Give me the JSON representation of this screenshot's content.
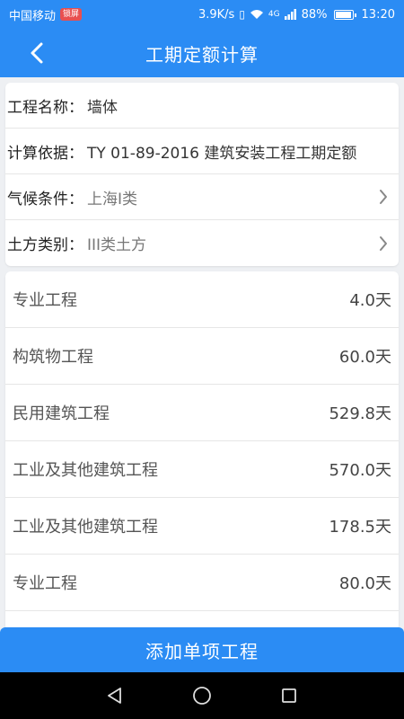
{
  "status_bar": {
    "carrier": "中国移动",
    "carrier_badge": "锁屏",
    "speed": "3.9K/s",
    "network": "4G",
    "battery": "88%",
    "time": "13:20"
  },
  "header": {
    "title": "工期定额计算"
  },
  "info": {
    "rows": [
      {
        "label": "工程名称：",
        "value": "墙体"
      },
      {
        "label": "计算依据：",
        "value": "TY 01-89-2016 建筑安装工程工期定额"
      },
      {
        "label": "气候条件：",
        "value": "上海I类"
      },
      {
        "label": "土方类别：",
        "value": "III类土方"
      }
    ]
  },
  "list": {
    "items": [
      {
        "name": "专业工程",
        "days": "4.0天"
      },
      {
        "name": "构筑物工程",
        "days": "60.0天"
      },
      {
        "name": "民用建筑工程",
        "days": "529.8天"
      },
      {
        "name": "工业及其他建筑工程",
        "days": "570.0天"
      },
      {
        "name": "工业及其他建筑工程",
        "days": "178.5天"
      },
      {
        "name": "专业工程",
        "days": "80.0天"
      }
    ]
  },
  "actions": {
    "add_label": "添加单项工程"
  },
  "colors": {
    "primary": "#2b8cf4",
    "background": "#eef0f3"
  }
}
